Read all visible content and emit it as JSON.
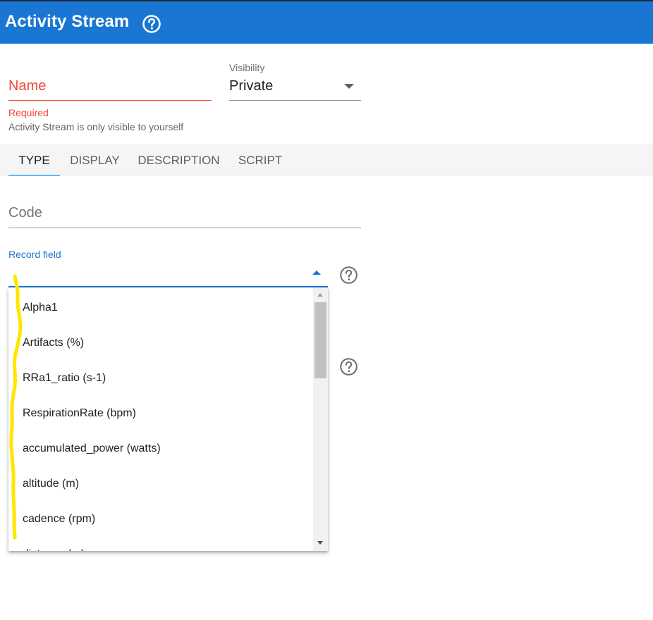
{
  "header": {
    "title": "Activity Stream",
    "help_icon": "help-circle-icon",
    "background_color": "#1976d2"
  },
  "form": {
    "name": {
      "label": "Name",
      "error": "Required",
      "hint": "Activity Stream is only visible to yourself",
      "error_color": "#f44336"
    },
    "visibility": {
      "label": "Visibility",
      "value": "Private"
    }
  },
  "tabs": [
    {
      "label": "TYPE",
      "active": true
    },
    {
      "label": "DISPLAY",
      "active": false
    },
    {
      "label": "DESCRIPTION",
      "active": false
    },
    {
      "label": "SCRIPT",
      "active": false
    }
  ],
  "code": {
    "placeholder": "Code"
  },
  "record_field": {
    "label": "Record field",
    "accent_color": "#1976d2",
    "options": [
      "Alpha1",
      "Artifacts (%)",
      "RRa1_ratio (s-1)",
      "RespirationRate (bpm)",
      "accumulated_power (watts)",
      "altitude (m)",
      "cadence (rpm)",
      "distance (m)"
    ]
  },
  "annotation": {
    "color": "#ffe600"
  }
}
